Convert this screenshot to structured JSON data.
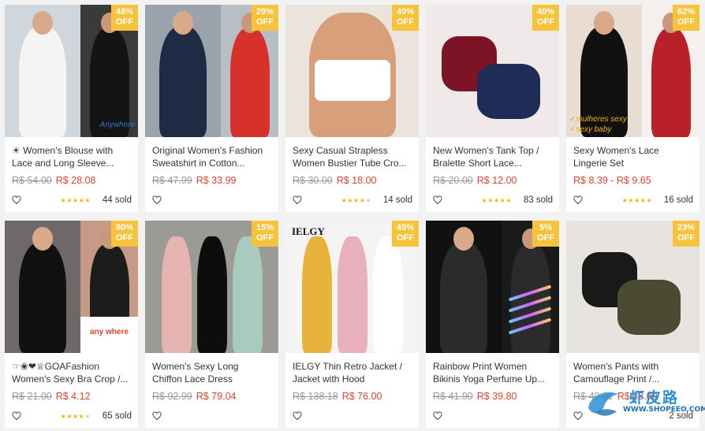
{
  "products": [
    {
      "badge_pct": "48%",
      "badge_off": "OFF",
      "title1": "☀ Women's Blouse with",
      "title2": "Lace and Long Sleeve...",
      "old_price": "R$ 54.00",
      "new_price": "R$ 28.08",
      "rating": 5,
      "sold": "44 sold",
      "caption": "Anywhere"
    },
    {
      "badge_pct": "29%",
      "badge_off": "OFF",
      "title1": "Original Women's Fashion",
      "title2": "Sweatshirt in Cotton...",
      "old_price": "R$ 47.99",
      "new_price": "R$ 33.99",
      "rating": 0,
      "sold": ""
    },
    {
      "badge_pct": "40%",
      "badge_off": "OFF",
      "title1": "Sexy Casual Strapless",
      "title2": "Women Bustier Tube Cro...",
      "old_price": "R$ 30.00",
      "new_price": "R$ 18.00",
      "rating": 4,
      "sold": "14 sold"
    },
    {
      "badge_pct": "40%",
      "badge_off": "OFF",
      "title1": "New Women's Tank Top /",
      "title2": "Bralette Short Lace...",
      "old_price": "R$ 20.00",
      "new_price": "R$ 12.00",
      "rating": 5,
      "sold": "83 sold"
    },
    {
      "badge_pct": "62%",
      "badge_off": "OFF",
      "title1": "Sexy Women's Lace",
      "title2": "Lingerie Set",
      "old_price": "",
      "new_price": "R$ 8.39 - R$ 9.65",
      "rating": 5,
      "sold": "16 sold",
      "caption1": "✓mulheres sexy",
      "caption2": "✓sexy baby"
    },
    {
      "badge_pct": "80%",
      "badge_off": "OFF",
      "title1": "☞❀❤♕GOAFashion",
      "title2": "Women's Sexy Bra Crop /...",
      "old_price": "R$ 21.00",
      "new_price": "R$ 4.12",
      "rating": 4,
      "sold": "65 sold",
      "caption": "any where"
    },
    {
      "badge_pct": "15%",
      "badge_off": "OFF",
      "title1": "Women's Sexy Long",
      "title2": "Chiffon Lace Dress",
      "old_price": "R$ 92.99",
      "new_price": "R$ 79.04",
      "rating": 0,
      "sold": ""
    },
    {
      "badge_pct": "45%",
      "badge_off": "OFF",
      "title1": "IELGY Thin Retro Jacket /",
      "title2": "Jacket with Hood",
      "old_price": "R$ 138.18",
      "new_price": "R$ 76.00",
      "rating": 0,
      "sold": "",
      "caption": "IELGY"
    },
    {
      "badge_pct": "5%",
      "badge_off": "OFF",
      "title1": "Rainbow Print Women",
      "title2": "Bikinis Yoga Perfume Up...",
      "old_price": "R$ 41.90",
      "new_price": "R$ 39.80",
      "rating": 0,
      "sold": ""
    },
    {
      "badge_pct": "23%",
      "badge_off": "OFF",
      "title1": "Women's Pants with",
      "title2": "Camouflage Print /...",
      "old_price": "R$ 49.00",
      "new_price": "R$ 38.00",
      "rating": 0,
      "sold": "2 sold"
    }
  ],
  "watermark": {
    "text": "虾皮路",
    "url": "WWW.SHOPEEO.COM"
  },
  "colors": {
    "badge": "#f6c33a",
    "price": "#e0442f",
    "star": "#f5b400"
  }
}
